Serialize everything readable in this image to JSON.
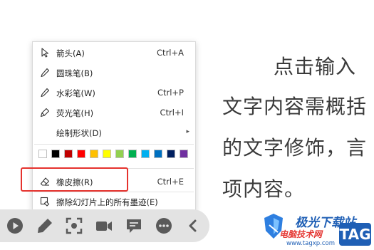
{
  "slide": {
    "line1": "点击输入",
    "line2": "文字内容需概括",
    "line3": "的文字修饰，言",
    "line4": "项内容。"
  },
  "menu": {
    "items": [
      {
        "label": "箭头(A)",
        "shortcut": "Ctrl+A",
        "icon": "arrow-pointer-icon"
      },
      {
        "label": "圆珠笔(B)",
        "shortcut": "",
        "icon": "ballpoint-pen-icon"
      },
      {
        "label": "水彩笔(W)",
        "shortcut": "Ctrl+P",
        "icon": "felt-pen-icon"
      },
      {
        "label": "荧光笔(H)",
        "shortcut": "Ctrl+I",
        "icon": "highlighter-icon"
      },
      {
        "label": "绘制形状(D)",
        "shortcut": "",
        "icon": ""
      },
      {
        "label": "橡皮擦(R)",
        "shortcut": "Ctrl+E",
        "icon": "eraser-icon"
      },
      {
        "label": "擦除幻灯片上的所有墨迹(E)",
        "shortcut": "",
        "icon": "erase-all-ink-icon"
      }
    ],
    "colors": [
      "#ffffff",
      "#000000",
      "#c00000",
      "#ff0000",
      "#ffc000",
      "#ffff00",
      "#92d050",
      "#00b050",
      "#00b0f0",
      "#0070c0",
      "#002060",
      "#7030a0"
    ]
  },
  "toolbar": {
    "buttons": [
      "play-icon",
      "pen-icon",
      "focus-icon",
      "camera-icon",
      "comment-icon",
      "more-icon",
      "collapse-icon"
    ]
  },
  "watermark": {
    "title": "极光下载站",
    "subtitle": "电脑技术网",
    "url": "www.tagxp.com",
    "tag": "TAG",
    "colors": {
      "blue": "#1f5fb5",
      "red": "#e53935"
    }
  },
  "highlight_color": "#e5322d"
}
